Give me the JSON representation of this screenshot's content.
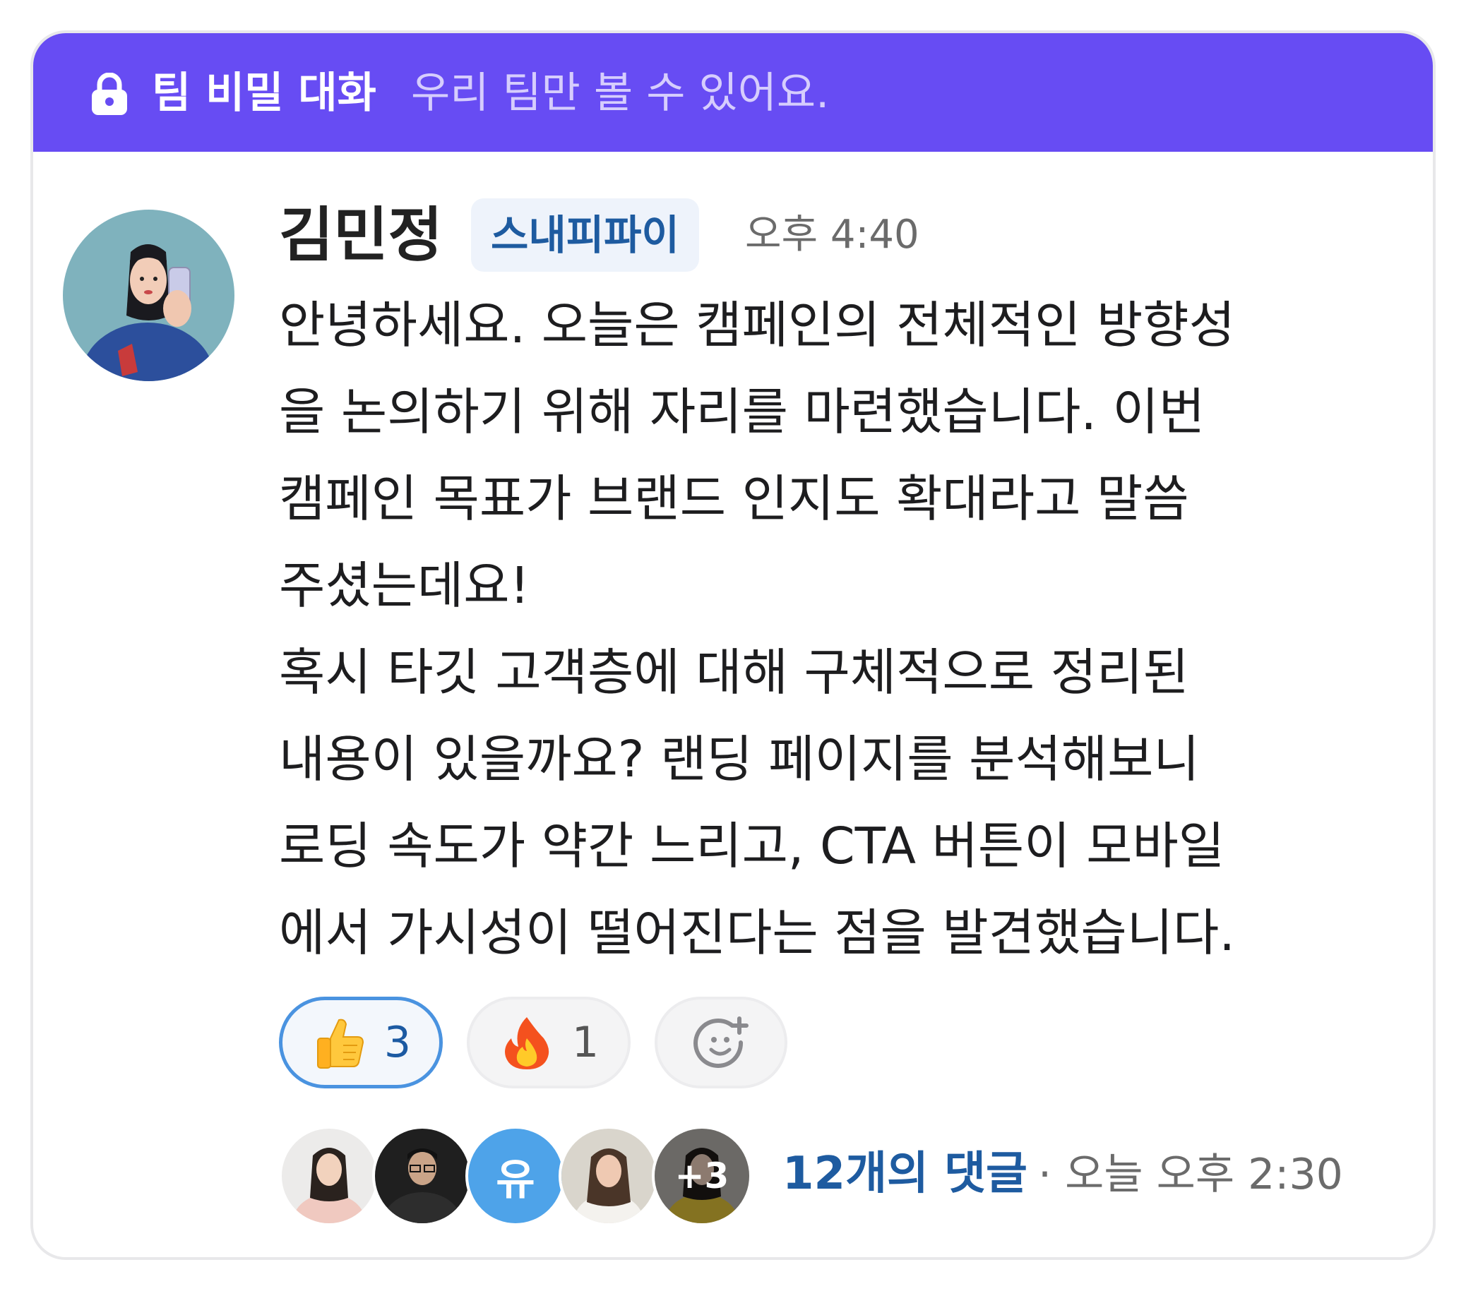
{
  "banner": {
    "icon": "lock-icon",
    "title": "팀 비밀 대화",
    "subtitle": "우리 팀만 볼 수 있어요.",
    "color": "#674cf3"
  },
  "message": {
    "author": "김민정",
    "org_badge": "스내피파이",
    "time": "오후 4:40",
    "lines": [
      "안녕하세요. 오늘은 캠페인의 전체적인 방향성",
      "을 논의하기 위해 자리를 마련했습니다. 이번",
      "캠페인 목표가 브랜드 인지도 확대라고 말씀",
      "주셨는데요!",
      "혹시 타깃 고객층에 대해 구체적으로 정리된",
      "내용이 있을까요? 랜딩 페이지를 분석해보니",
      "로딩 속도가 약간 느리고, CTA 버튼이 모바일",
      "에서 가시성이 떨어진다는 점을 발견했습니다."
    ]
  },
  "reactions": [
    {
      "emoji": "thumbs-up",
      "count": "3",
      "active": true
    },
    {
      "emoji": "fire",
      "count": "1",
      "active": false
    }
  ],
  "add_reaction_icon": "add-emoji-icon",
  "thread": {
    "initial_avatar": "유",
    "more_count": "+3",
    "comments_label": "12개의 댓글",
    "last_reply": "· 오늘 오후 2:30"
  },
  "colors": {
    "accent": "#674cf3",
    "link": "#1e5ba0",
    "active_reaction_border": "#4a93e0"
  }
}
